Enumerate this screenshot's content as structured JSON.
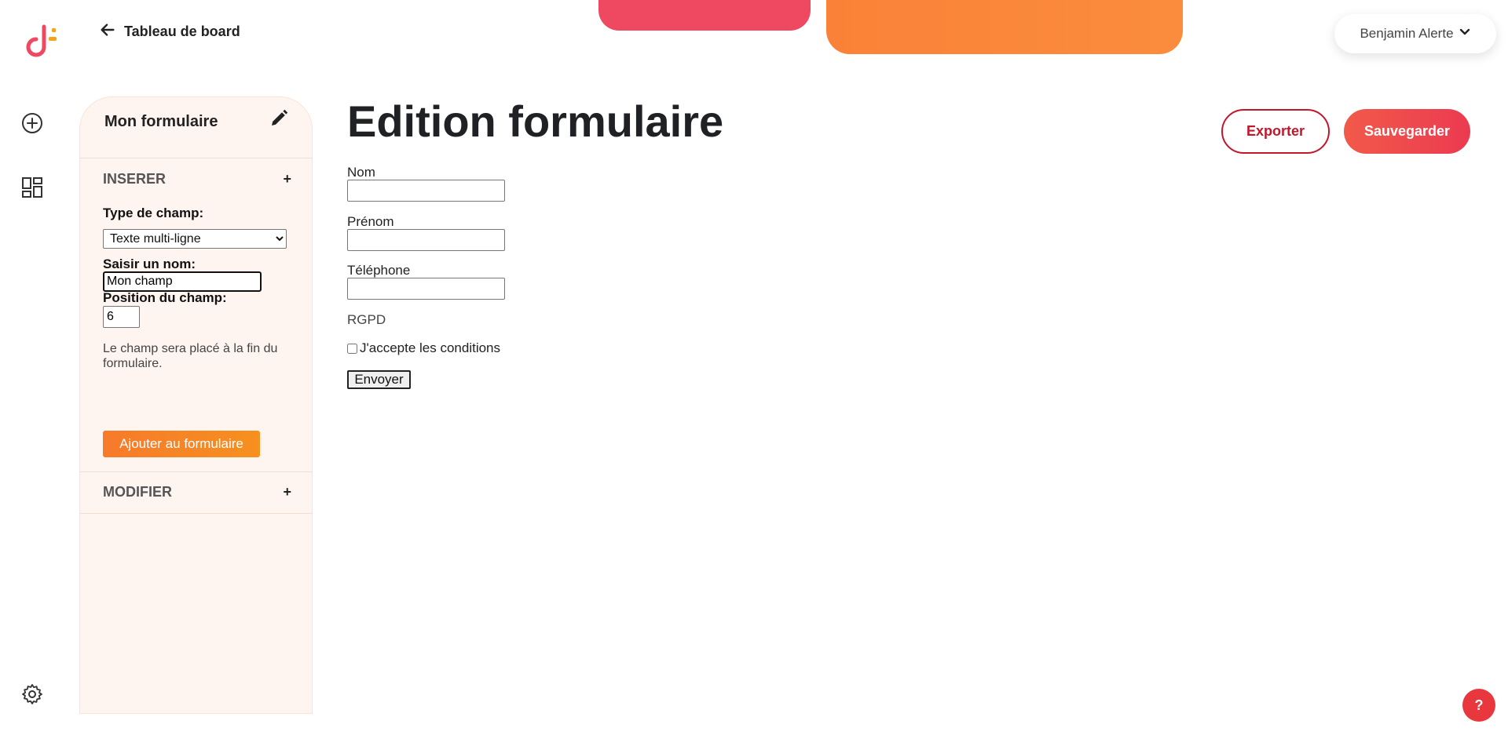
{
  "header": {
    "back_label": "Tableau de board",
    "user_name": "Benjamin Alerte"
  },
  "sidebar_panel": {
    "title": "Mon formulaire",
    "insert_section": {
      "title": "INSERER",
      "toggle": "+",
      "field_type_label": "Type de champ:",
      "field_type_value": "Texte multi-ligne",
      "name_label": "Saisir un nom:",
      "name_value": "Mon champ",
      "position_label": "Position du champ:",
      "position_value": "6",
      "hint": "Le champ sera placé à la fin du formulaire.",
      "add_button": "Ajouter au formulaire"
    },
    "modify_section": {
      "title": "MODIFIER",
      "toggle": "+"
    }
  },
  "main": {
    "title": "Edition formulaire",
    "export_button": "Exporter",
    "save_button": "Sauvegarder",
    "form": {
      "fields": [
        {
          "label": "Nom"
        },
        {
          "label": "Prénom"
        },
        {
          "label": "Téléphone"
        }
      ],
      "rgpd_label": "RGPD",
      "consent_label": "J'accepte les conditions",
      "submit_label": "Envoyer"
    }
  },
  "help_button": "?",
  "colors": {
    "accent_red": "#ec3a51",
    "accent_orange": "#f77a2b",
    "panel_bg": "#fff5f0",
    "export_border": "#c3162b"
  },
  "icons": [
    "logo",
    "arrow-left-icon",
    "chevron-down-icon",
    "plus-circle-icon",
    "dashboard-icon",
    "gear-icon",
    "pencil-icon"
  ]
}
